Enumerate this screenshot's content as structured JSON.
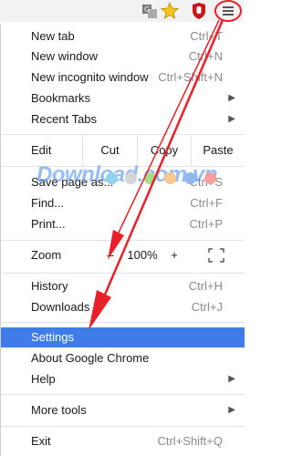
{
  "menu": {
    "new_tab": {
      "label": "New tab",
      "shortcut": "Ctrl+T"
    },
    "new_window": {
      "label": "New window",
      "shortcut": "Ctrl+N"
    },
    "new_incognito": {
      "label": "New incognito window",
      "shortcut": "Ctrl+Shift+N"
    },
    "bookmarks": {
      "label": "Bookmarks"
    },
    "recent_tabs": {
      "label": "Recent Tabs"
    },
    "edit": {
      "label": "Edit",
      "cut": "Cut",
      "copy": "Copy",
      "paste": "Paste"
    },
    "save_page": {
      "label": "Save page as...",
      "shortcut": "Ctrl+S"
    },
    "find": {
      "label": "Find...",
      "shortcut": "Ctrl+F"
    },
    "print": {
      "label": "Print...",
      "shortcut": "Ctrl+P"
    },
    "zoom": {
      "label": "Zoom",
      "minus": "–",
      "level": "100%",
      "plus": "+"
    },
    "history": {
      "label": "History",
      "shortcut": "Ctrl+H"
    },
    "downloads": {
      "label": "Downloads",
      "shortcut": "Ctrl+J"
    },
    "settings": {
      "label": "Settings"
    },
    "about": {
      "label": "About Google Chrome"
    },
    "help": {
      "label": "Help"
    },
    "more_tools": {
      "label": "More tools"
    },
    "exit": {
      "label": "Exit",
      "shortcut": "Ctrl+Shift+Q"
    }
  },
  "watermark": {
    "text": "Download.com.vn"
  },
  "colors": {
    "highlight": "#3e7ce8",
    "annotation": "#e8202a"
  }
}
